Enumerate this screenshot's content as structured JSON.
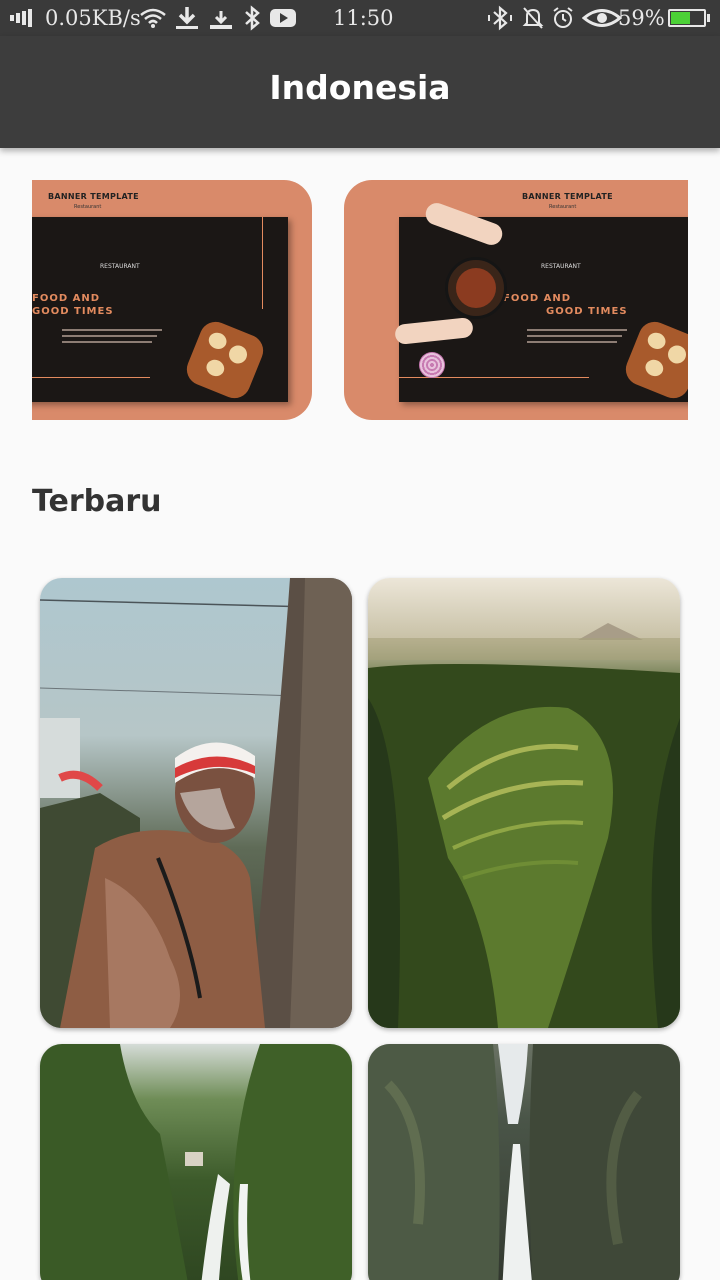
{
  "status_bar": {
    "network_speed": "0.05KB/s",
    "time": "11:50",
    "battery_percent": "59%",
    "battery_level": 0.59,
    "icons_left": [
      "signal-icon",
      "wifi-icon",
      "download-icon",
      "download-tray-icon",
      "bluetooth-icon",
      "youtube-icon"
    ],
    "icons_right": [
      "bluetooth-vibrate-icon",
      "bell-off-icon",
      "alarm-icon",
      "eye-icon",
      "battery-charging-icon"
    ]
  },
  "app_bar": {
    "title": "Indonesia"
  },
  "banners": [
    {
      "heading": "BANNER TEMPLATE",
      "subheading": "Restaurant",
      "brand": "RESTAURANT",
      "line1": "FOOD AND",
      "line2": "GOOD TIMES"
    },
    {
      "heading": "BANNER TEMPLATE",
      "subheading": "Restaurant",
      "brand": "RESTAURANT",
      "line1": "FOOD AND",
      "line2": "GOOD TIMES"
    }
  ],
  "section": {
    "title": "Terbaru"
  },
  "cards": [
    {
      "subject": "elderly-man-red-white-headband-photo"
    },
    {
      "subject": "rice-terraces-aerial-photo"
    },
    {
      "subject": "jungle-waterfall-photo"
    },
    {
      "subject": "canyon-waterfall-photo"
    }
  ],
  "colors": {
    "status_bar": "#3a3a3a",
    "app_bar": "#3d3d3d",
    "banner_bg": "#d98a6a",
    "banner_accent": "#e38b5f",
    "background": "#fafafa"
  }
}
